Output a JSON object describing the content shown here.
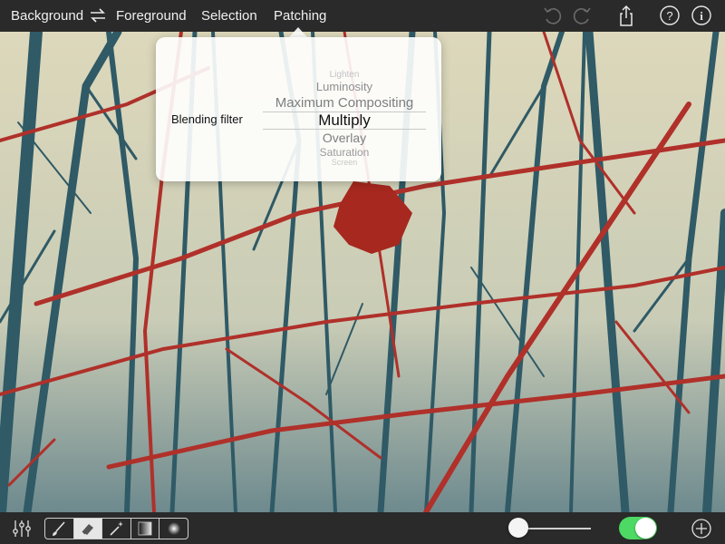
{
  "topbar": {
    "background_label": "Background",
    "swap_icon": "swap-arrows-icon",
    "foreground_label": "Foreground",
    "selection_label": "Selection",
    "patching_label": "Patching",
    "right_icons": [
      "undo-icon",
      "redo-icon",
      "share-icon",
      "help-icon",
      "info-icon"
    ]
  },
  "popover": {
    "label": "Blending filter",
    "options": [
      "Lighten",
      "Luminosity",
      "Maximum Compositing",
      "Multiply",
      "Overlay",
      "Saturation",
      "Screen"
    ],
    "selected": "Multiply"
  },
  "bottombar": {
    "icons": [
      "adjustments-icon",
      "brush-icon",
      "eraser-icon",
      "magic-wand-icon",
      "gradient-icon",
      "radial-icon",
      "add-icon"
    ],
    "active_tool": "eraser",
    "slider_value": 0.0,
    "toggle_on": true
  },
  "colors": {
    "toolbar": "#2a2a2a",
    "sky": "#d8d3b5",
    "thorns": "#b0302a",
    "trees": "#2f5a66",
    "toggle_on": "#4cd964"
  }
}
